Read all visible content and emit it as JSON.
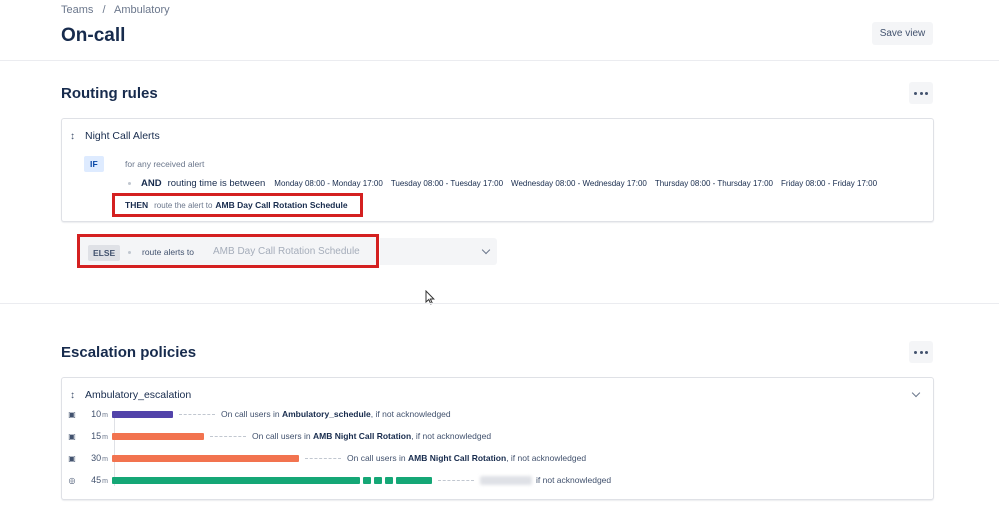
{
  "header": {
    "breadcrumb": [
      "Teams",
      "/",
      "Ambulatory"
    ],
    "title": "On-call",
    "save_view": "Save view"
  },
  "routing": {
    "title": "Routing rules",
    "rule": {
      "name": "Night Call Alerts",
      "if_label": "IF",
      "if_text": "for any received alert",
      "and_label": "AND",
      "condition": "routing time is between",
      "time_ranges": [
        "Monday 08:00 - Monday 17:00",
        "Tuesday 08:00 - Tuesday 17:00",
        "Wednesday 08:00 - Wednesday 17:00",
        "Thursday 08:00 - Thursday 17:00",
        "Friday 08:00 - Friday 17:00"
      ],
      "then_label": "THEN",
      "then_text": "route the alert to",
      "then_target": "AMB Day Call Rotation Schedule"
    },
    "else": {
      "label": "ELSE",
      "text": "route alerts to",
      "selected": "AMB Day Call Rotation Schedule"
    }
  },
  "escalation": {
    "title": "Escalation policies",
    "policy_name": "Ambulatory_escalation",
    "unit": "m",
    "steps": [
      {
        "time": "10",
        "icon": "calendar-icon",
        "prefix": "On call users in",
        "target": "Ambulatory_schedule",
        "suffix": ", if not acknowledged",
        "color": "#5243aa",
        "fill": 0.18
      },
      {
        "time": "15",
        "icon": "calendar-icon",
        "prefix": "On call users in",
        "target": "AMB Night Call Rotation",
        "suffix": ", if not acknowledged",
        "color": "#f2734f",
        "fill": 0.27
      },
      {
        "time": "30",
        "icon": "calendar-icon",
        "prefix": "On call users in",
        "target": "AMB Night Call Rotation",
        "suffix": ", if not acknowledged",
        "color": "#f2734f",
        "fill": 0.55
      },
      {
        "time": "45",
        "icon": "user-icon",
        "prefix": "",
        "target": "",
        "suffix": "if not acknowledged",
        "color": "#15a776",
        "fill": 0.73
      }
    ]
  },
  "colors": {
    "highlight_box": "#d42020",
    "if_lozenge_bg": "#deebff"
  }
}
